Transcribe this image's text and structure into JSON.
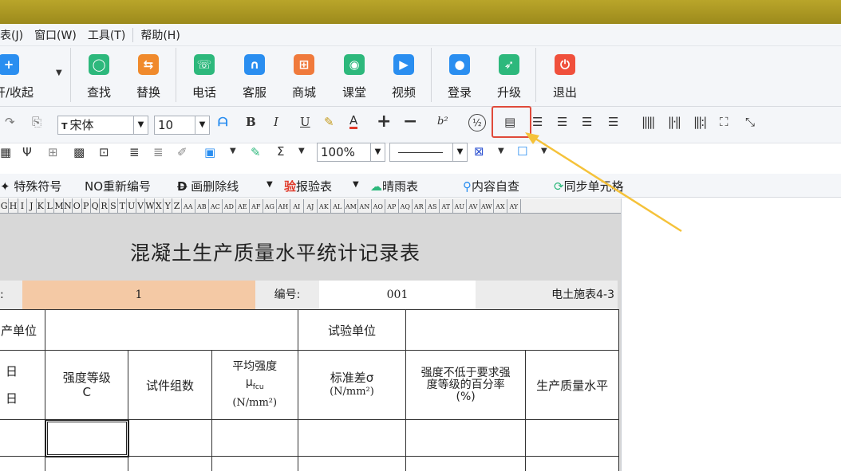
{
  "menu": [
    {
      "label": "表(J)"
    },
    {
      "label": "窗口(W)"
    },
    {
      "label": "工具(T)"
    },
    {
      "label": "帮助(H)"
    }
  ],
  "ribbon": {
    "open_collapse": "开/收起",
    "buttons": [
      {
        "label": "查找",
        "icon": "search-icon",
        "color": "#2db87c"
      },
      {
        "label": "替换",
        "icon": "replace-icon",
        "color": "#f08a2c"
      },
      {
        "label": "电话",
        "icon": "phone-icon",
        "color": "#2db87c"
      },
      {
        "label": "客服",
        "icon": "headset-icon",
        "color": "#2a8ef0"
      },
      {
        "label": "商城",
        "icon": "cart-icon",
        "color": "#f07a3c"
      },
      {
        "label": "课堂",
        "icon": "classroom-icon",
        "color": "#2db87c"
      },
      {
        "label": "视频",
        "icon": "video-icon",
        "color": "#2a8ef0"
      },
      {
        "label": "登录",
        "icon": "user-icon",
        "color": "#2a8ef0"
      },
      {
        "label": "升级",
        "icon": "rocket-icon",
        "color": "#2db87c"
      },
      {
        "label": "退出",
        "icon": "power-icon",
        "color": "#f0503c"
      }
    ]
  },
  "format": {
    "font_name": "宋体",
    "font_size": "10",
    "bold": "B",
    "italic": "I",
    "underline": "U",
    "font_color_label": "A",
    "superscript": "b²",
    "zoom": "100%",
    "sigma": "Σ"
  },
  "symbols": [
    {
      "label": "特殊符号"
    },
    {
      "label": "NO重新编号"
    },
    {
      "label": "画删除线"
    },
    {
      "label": "报验表"
    },
    {
      "label": "晴雨表"
    },
    {
      "label": "内容自查"
    },
    {
      "label": "同步单元格"
    }
  ],
  "col_headers": [
    "G",
    "H",
    "I",
    "J",
    "K",
    "L",
    "M",
    "N",
    "O",
    "P",
    "Q",
    "R",
    "S",
    "T",
    "U",
    "V",
    "W",
    "X",
    "Y",
    "Z",
    "AA",
    "AB",
    "AC",
    "AD",
    "AE",
    "AF",
    "AG",
    "AH",
    "AI",
    "AJ",
    "AK",
    "AL",
    "AM",
    "AN",
    "AO",
    "AP",
    "AQ",
    "AR",
    "AS",
    "AT",
    "AU",
    "AV",
    "AW",
    "AX",
    "AY"
  ],
  "document": {
    "title": "混凝土生产质量水平统计记录表",
    "info_left_label": ":",
    "info_value": "1",
    "number_label": "编号:",
    "number_value": "001",
    "form_code": "电土施表4-3",
    "production_unit": "产单位",
    "test_unit": "试验单位",
    "date_1": "日",
    "date_2": "日",
    "headers": {
      "strength_grade": "强度等级",
      "strength_grade_sub": "C",
      "specimen_groups": "试件组数",
      "avg_strength": "平均强度",
      "avg_strength_symbol": "μ",
      "avg_strength_sub": "fcu",
      "avg_strength_unit": "(N/mm²)",
      "std_dev": "标准差σ",
      "std_dev_unit": "(N/mm²)",
      "pct_line1": "强度不低于要求强",
      "pct_line2": "度等级的百分率",
      "pct_line3": "(%)",
      "quality_level": "生产质量水平"
    }
  }
}
